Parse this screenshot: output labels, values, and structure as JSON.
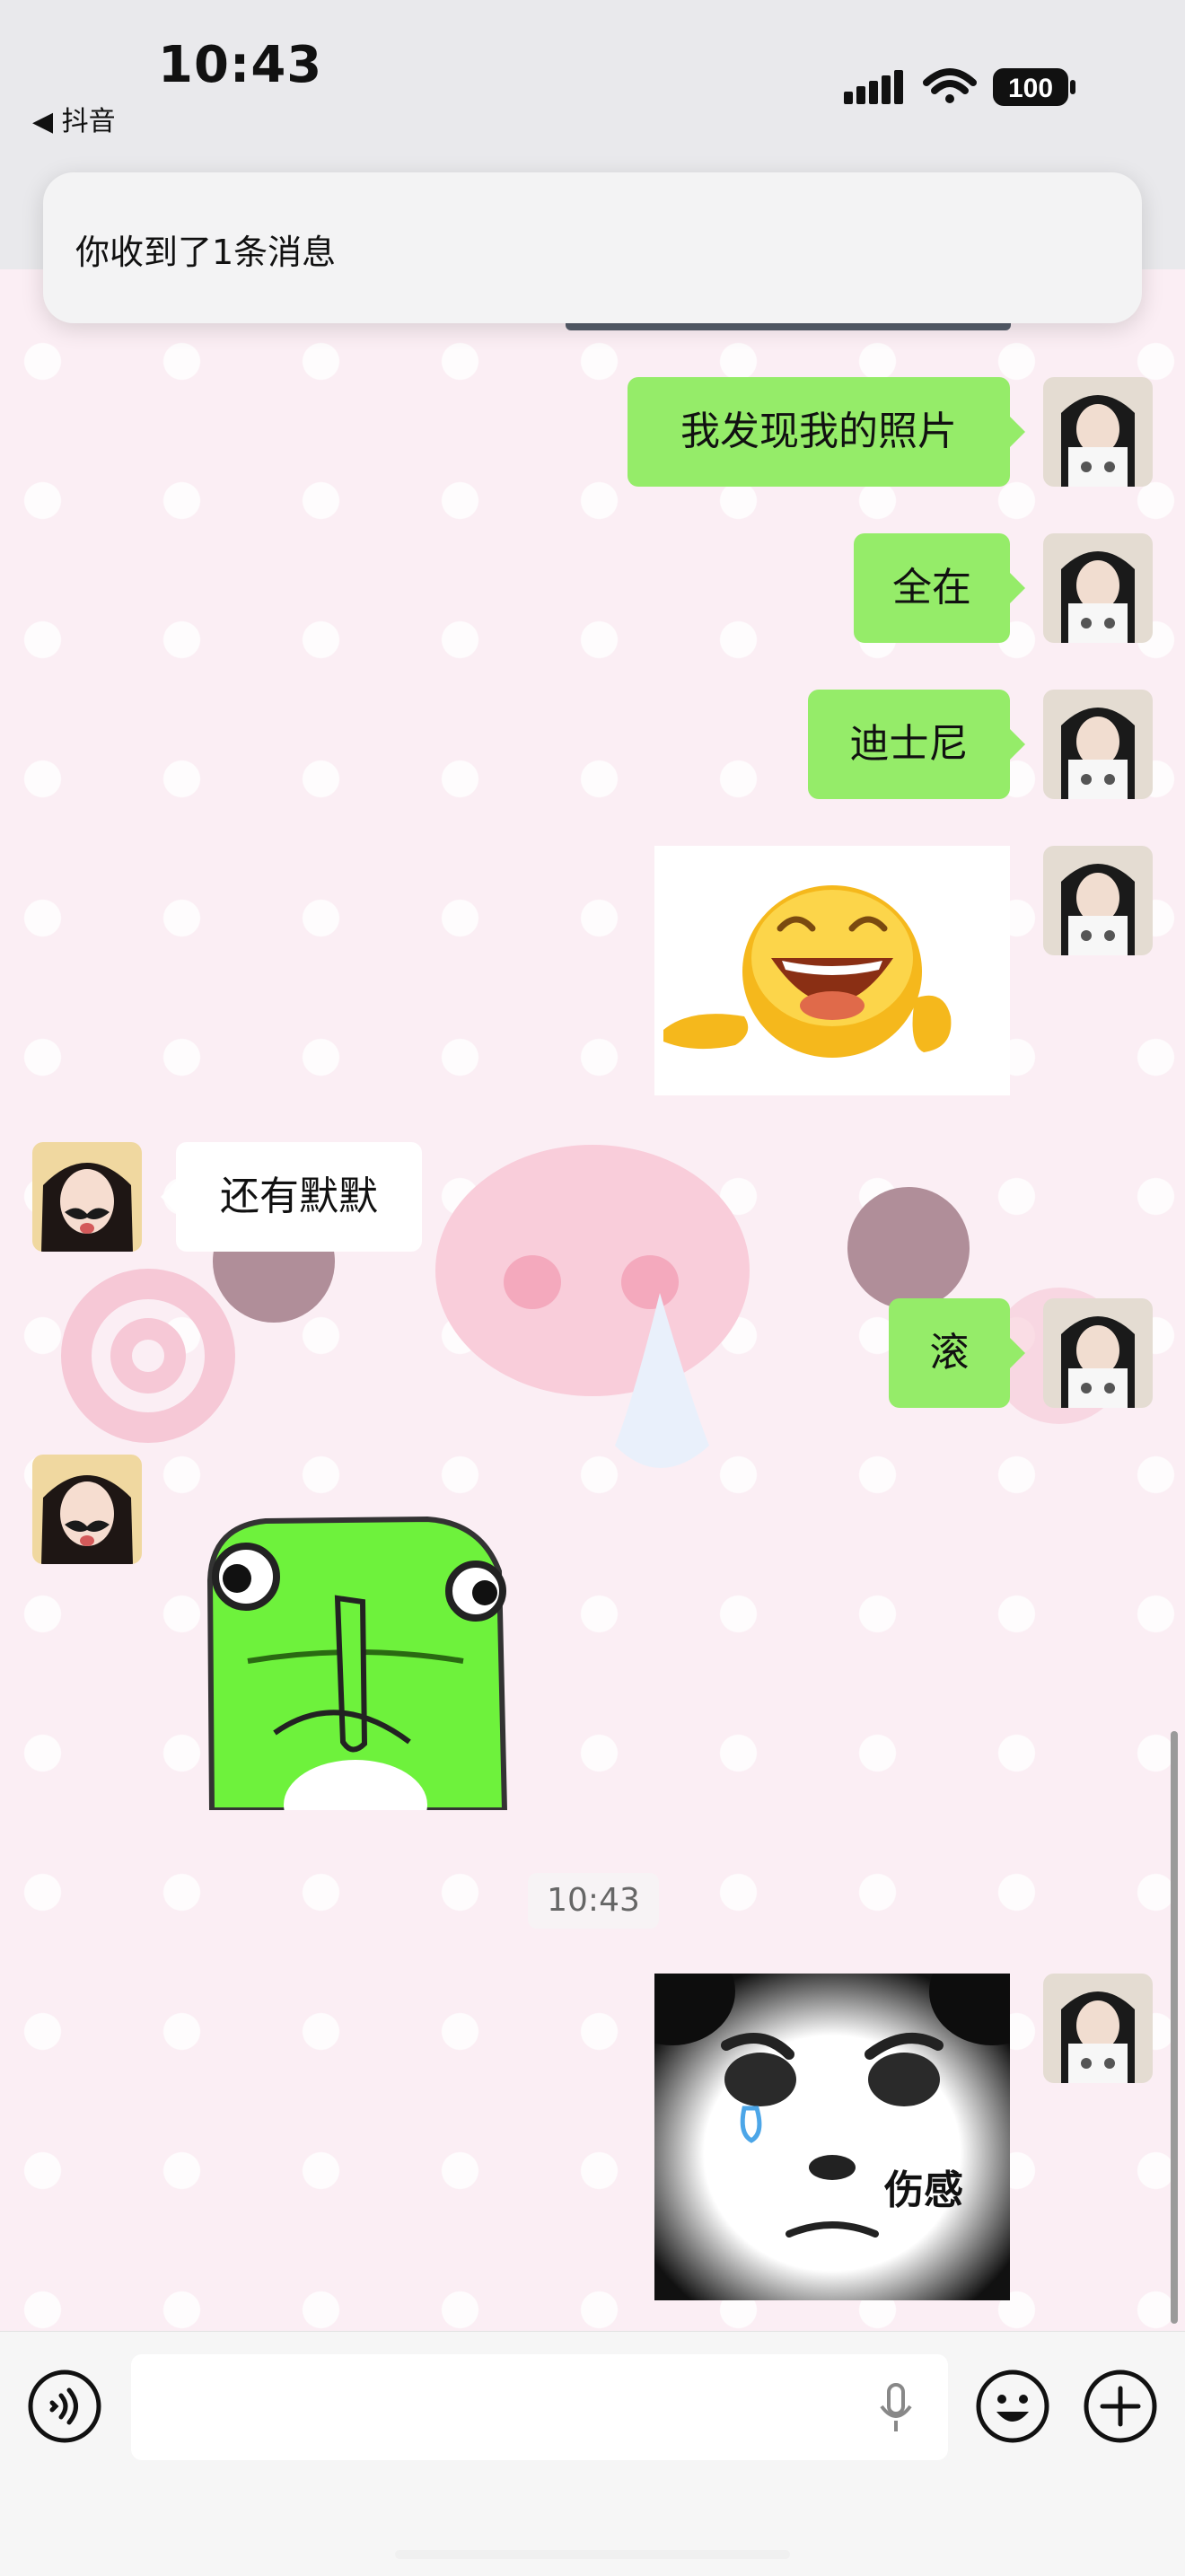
{
  "status_bar": {
    "time": "10:43",
    "back_app": "◀ 抖音",
    "battery": "100",
    "signal_icon": "cellular-signal-icon",
    "wifi_icon": "wifi-icon",
    "battery_icon": "battery-icon"
  },
  "notification": {
    "text": "你收到了1条消息"
  },
  "messages": [
    {
      "sender": "me",
      "type": "text",
      "text": "我发现我的照片"
    },
    {
      "sender": "me",
      "type": "text",
      "text": "全在"
    },
    {
      "sender": "me",
      "type": "text",
      "text": "迪士尼"
    },
    {
      "sender": "me",
      "type": "sticker",
      "sticker": "laughing-emoji-sticker"
    },
    {
      "sender": "other",
      "type": "text",
      "text": "还有默默"
    },
    {
      "sender": "me",
      "type": "text",
      "text": "滚"
    },
    {
      "sender": "other",
      "type": "sticker",
      "sticker": "green-frog-shush-sticker"
    },
    {
      "sender": "me",
      "type": "sticker",
      "sticker": "sad-panda-face-sticker",
      "caption": "伤感"
    }
  ],
  "timestamp": "10:43",
  "input_bar": {
    "voice_icon": "voice-mode-icon",
    "mic_icon": "microphone-icon",
    "emoji_icon": "emoji-icon",
    "plus_icon": "plus-icon"
  },
  "colors": {
    "my_bubble": "#95ec69",
    "other_bubble": "#ffffff",
    "chat_background": "#fbeef4"
  }
}
